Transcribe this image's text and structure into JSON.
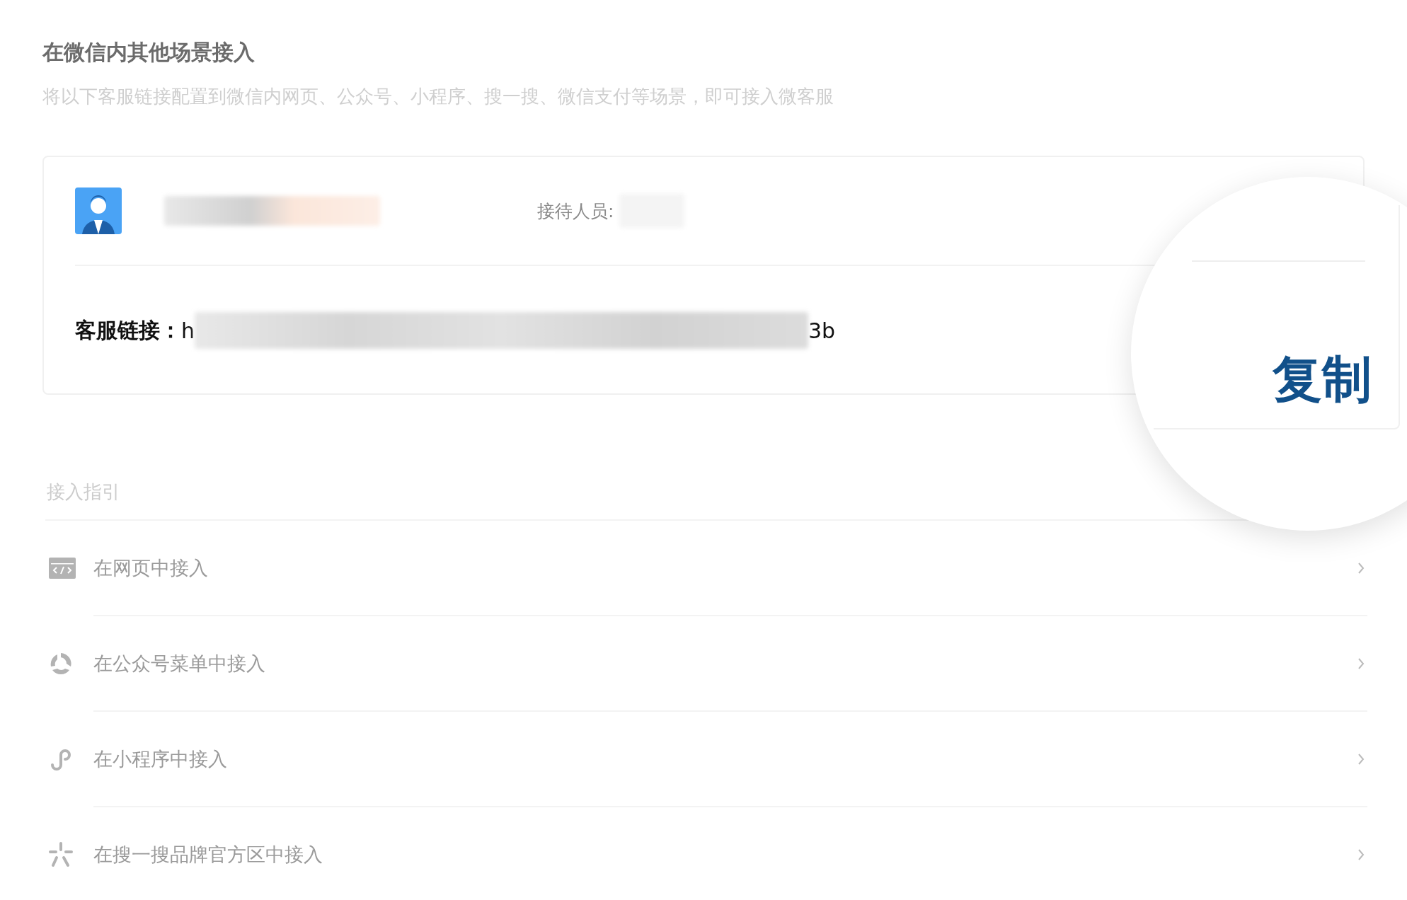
{
  "section": {
    "title": "在微信内其他场景接入",
    "subtitle": "将以下客服链接配置到微信内网页、公众号、小程序、搜一搜、微信支付等场景，即可接入微客服"
  },
  "card": {
    "agent_label": "接待人员:",
    "link_label": "客服链接：",
    "link_start": "h",
    "link_end": "3b"
  },
  "magnifier": {
    "copy_button": "复制"
  },
  "guide": {
    "title": "接入指引",
    "items": [
      {
        "kind": "web",
        "label": "在网页中接入"
      },
      {
        "kind": "official_account",
        "label": "在公众号菜单中接入"
      },
      {
        "kind": "mini_program",
        "label": "在小程序中接入"
      },
      {
        "kind": "search",
        "label": "在搜一搜品牌官方区中接入"
      }
    ]
  }
}
